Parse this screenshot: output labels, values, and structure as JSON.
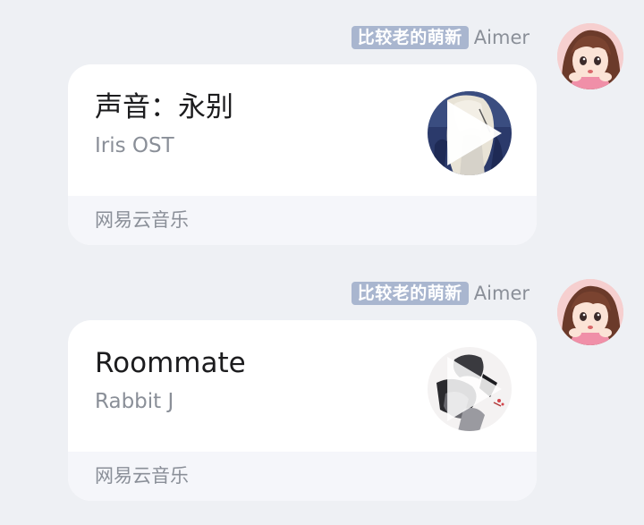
{
  "messages": [
    {
      "sender_badge": "比较老的萌新",
      "sender_name": "Aimer",
      "card": {
        "title": "声音：永别",
        "subtitle": "Iris OST",
        "source": "网易云音乐",
        "cover_icon": "album-cover",
        "play_icon": "play-icon"
      }
    },
    {
      "sender_badge": "比较老的萌新",
      "sender_name": "Aimer",
      "card": {
        "title": "Roommate",
        "subtitle": "Rabbit J",
        "source": "网易云音乐",
        "cover_icon": "album-cover",
        "play_icon": "play-icon"
      }
    }
  ],
  "colors": {
    "background": "#eef0f4",
    "badge": "#a9b6cf",
    "card": "#ffffff",
    "card_footer": "#f5f6fa",
    "secondary_text": "#8a8f98"
  }
}
